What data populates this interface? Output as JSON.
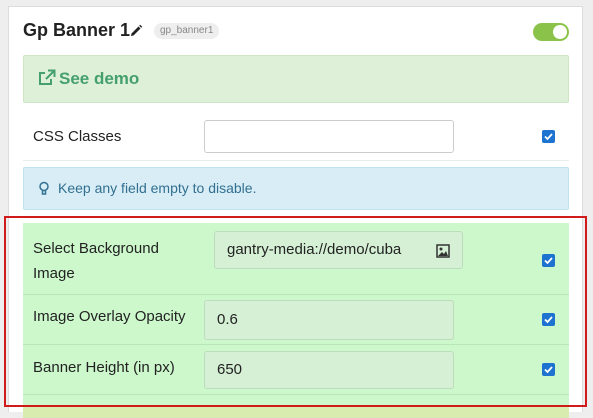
{
  "header": {
    "title": "Gp Banner 1",
    "tag": "gp_banner1",
    "enabled": true
  },
  "demo": {
    "label": "See demo"
  },
  "css_classes": {
    "label": "CSS Classes",
    "value": "",
    "checked": true
  },
  "info": {
    "text": "Keep any field empty to disable."
  },
  "fields": [
    {
      "label": "Select Background Image",
      "value": "gantry-media://demo/cuba",
      "checked": true
    },
    {
      "label": "Image Overlay Opacity",
      "value": "0.6",
      "checked": true
    },
    {
      "label": "Banner Height (in px)",
      "value": "650",
      "checked": true
    }
  ],
  "colors": {
    "accent": "#1e73d0",
    "toggle_on": "#8bc34a",
    "demo_text": "#45a06e",
    "highlight_border": "#d11a1a",
    "edited_background": "#ccf8cc"
  },
  "icons": [
    "pencil-icon",
    "external-link-icon",
    "lightbulb-icon",
    "image-picker-icon",
    "checkmark-icon"
  ]
}
